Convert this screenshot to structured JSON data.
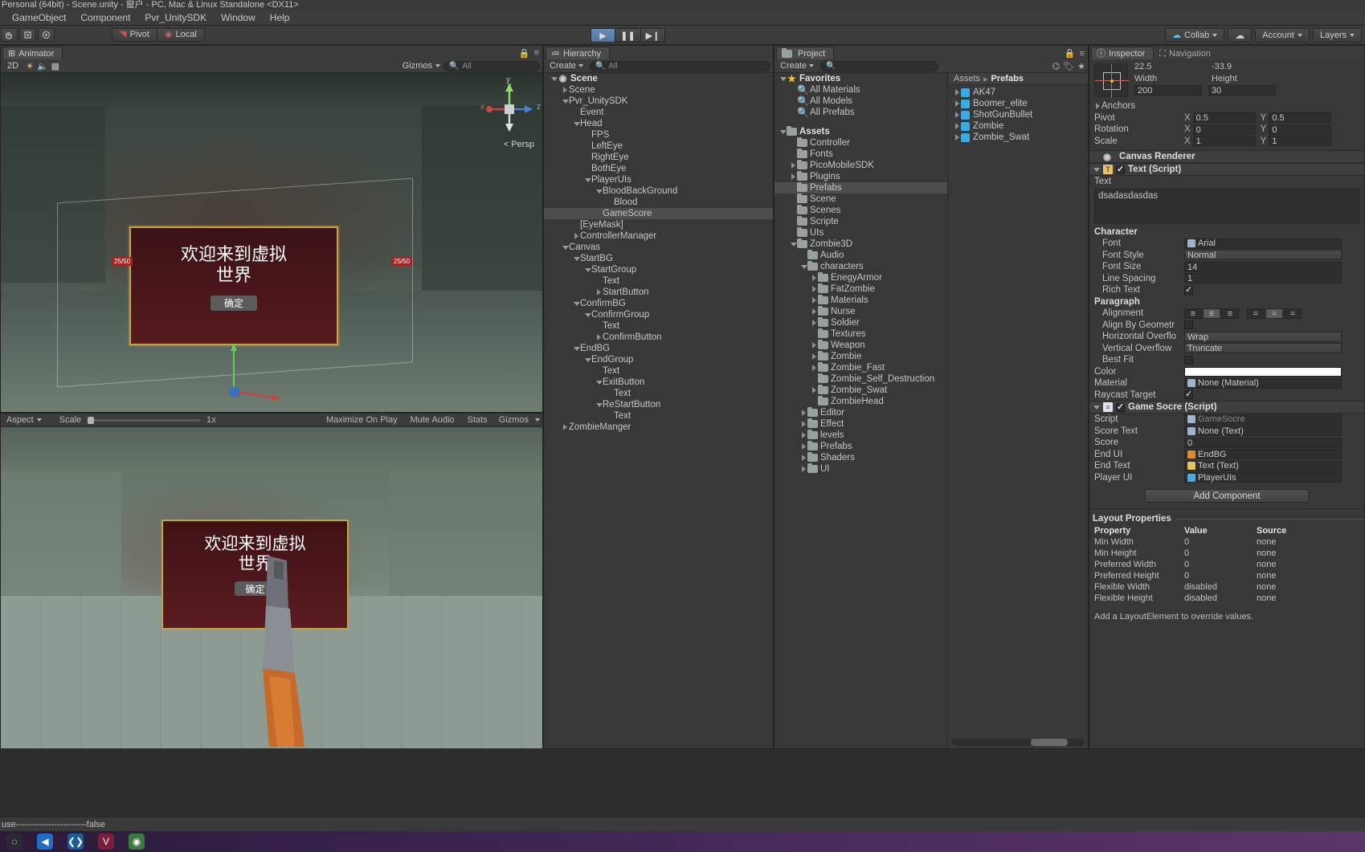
{
  "window": {
    "title": "Personal (64bit) - Scene.unity - 窗户 - PC, Mac & Linux Standalone <DX11>"
  },
  "menubar": {
    "items": [
      "GameObject",
      "Component",
      "Pvr_UnitySDK",
      "Window",
      "Help"
    ]
  },
  "toolbar": {
    "transform_tools": [
      "hand-tool",
      "move-tool",
      "rotate-tool",
      "rect-tool"
    ],
    "pivot_label": "Pivot",
    "local_label": "Local",
    "play_label": "▶",
    "pause_label": "❚❚",
    "step_label": "▶❙",
    "collab_label": "Collab",
    "cloud_label": "cloud",
    "account_label": "Account",
    "layers_label": "Layers"
  },
  "animator_panel": {
    "tab": "Animator",
    "subbar": [
      "2D",
      "light",
      "audio",
      "fx",
      "grid"
    ],
    "gizmos_label": "Gizmos",
    "all_label": "All"
  },
  "scene_view": {
    "persp_label": "Persp",
    "axis_x": "x",
    "axis_y": "y",
    "axis_z": "z",
    "overlay_title_line1": "欢迎来到虚拟",
    "overlay_title_line2": "世界",
    "overlay_button": "确定",
    "hp_left": "25/50",
    "hp_right": "25/50"
  },
  "game_panel": {
    "aspect_label": "Aspect",
    "scale_label": "Scale",
    "scale_value": "1x",
    "maximize_label": "Maximize On Play",
    "mute_label": "Mute Audio",
    "stats_label": "Stats",
    "gizmos_label": "Gizmos",
    "overlay_title_line1": "欢迎来到虚拟",
    "overlay_title_line2": "世界",
    "overlay_button": "确定"
  },
  "hierarchy": {
    "tab": "Hierarchy",
    "create_label": "Create",
    "search_placeholder": "All",
    "items": [
      {
        "label": "Scene",
        "depth": 0,
        "tri": "down",
        "icon": "unity",
        "bold": true
      },
      {
        "label": "Scene",
        "depth": 1,
        "tri": "right",
        "icon": "none"
      },
      {
        "label": "Pvr_UnitySDK",
        "depth": 1,
        "tri": "down",
        "icon": "none"
      },
      {
        "label": "Event",
        "depth": 2,
        "tri": "none",
        "icon": "none"
      },
      {
        "label": "Head",
        "depth": 2,
        "tri": "down",
        "icon": "none"
      },
      {
        "label": "FPS",
        "depth": 3,
        "tri": "none",
        "icon": "none"
      },
      {
        "label": "LeftEye",
        "depth": 3,
        "tri": "none",
        "icon": "none"
      },
      {
        "label": "RightEye",
        "depth": 3,
        "tri": "none",
        "icon": "none"
      },
      {
        "label": "BothEye",
        "depth": 3,
        "tri": "none",
        "icon": "none"
      },
      {
        "label": "PlayerUIs",
        "depth": 3,
        "tri": "down",
        "icon": "none"
      },
      {
        "label": "BloodBackGround",
        "depth": 4,
        "tri": "down",
        "icon": "none"
      },
      {
        "label": "Blood",
        "depth": 5,
        "tri": "none",
        "icon": "none"
      },
      {
        "label": "GameScore",
        "depth": 4,
        "tri": "none",
        "icon": "none",
        "selected": true
      },
      {
        "label": "[EyeMask]",
        "depth": 2,
        "tri": "none",
        "icon": "none"
      },
      {
        "label": "ControllerManager",
        "depth": 2,
        "tri": "right",
        "icon": "none"
      },
      {
        "label": "Canvas",
        "depth": 1,
        "tri": "down",
        "icon": "none"
      },
      {
        "label": "StartBG",
        "depth": 2,
        "tri": "down",
        "icon": "none"
      },
      {
        "label": "StartGroup",
        "depth": 3,
        "tri": "down",
        "icon": "none"
      },
      {
        "label": "Text",
        "depth": 4,
        "tri": "none",
        "icon": "none"
      },
      {
        "label": "StartButton",
        "depth": 4,
        "tri": "right",
        "icon": "none"
      },
      {
        "label": "ConfirmBG",
        "depth": 2,
        "tri": "down",
        "icon": "none"
      },
      {
        "label": "ConfirmGroup",
        "depth": 3,
        "tri": "down",
        "icon": "none"
      },
      {
        "label": "Text",
        "depth": 4,
        "tri": "none",
        "icon": "none"
      },
      {
        "label": "ConfirmButton",
        "depth": 4,
        "tri": "right",
        "icon": "none"
      },
      {
        "label": "EndBG",
        "depth": 2,
        "tri": "down",
        "icon": "none"
      },
      {
        "label": "EndGroup",
        "depth": 3,
        "tri": "down",
        "icon": "none"
      },
      {
        "label": "Text",
        "depth": 4,
        "tri": "none",
        "icon": "none"
      },
      {
        "label": "ExitButton",
        "depth": 4,
        "tri": "down",
        "icon": "none"
      },
      {
        "label": "Text",
        "depth": 5,
        "tri": "none",
        "icon": "none"
      },
      {
        "label": "ReStartButton",
        "depth": 4,
        "tri": "down",
        "icon": "none"
      },
      {
        "label": "Text",
        "depth": 5,
        "tri": "none",
        "icon": "none"
      },
      {
        "label": "ZombieManger",
        "depth": 1,
        "tri": "right",
        "icon": "none"
      }
    ]
  },
  "project": {
    "tab": "Project",
    "create_label": "Create",
    "search_placeholder": "",
    "tree": [
      {
        "label": "Favorites",
        "depth": 0,
        "tri": "down",
        "icon": "star",
        "bold": true
      },
      {
        "label": "All Materials",
        "depth": 1,
        "tri": "none",
        "icon": "search"
      },
      {
        "label": "All Models",
        "depth": 1,
        "tri": "none",
        "icon": "search"
      },
      {
        "label": "All Prefabs",
        "depth": 1,
        "tri": "none",
        "icon": "search"
      },
      {
        "label": "",
        "depth": 0,
        "tri": "none",
        "icon": "none",
        "spacer": true
      },
      {
        "label": "Assets",
        "depth": 0,
        "tri": "down",
        "icon": "folder",
        "bold": true
      },
      {
        "label": "Controller",
        "depth": 1,
        "tri": "none",
        "icon": "folder"
      },
      {
        "label": "Fonts",
        "depth": 1,
        "tri": "none",
        "icon": "folder"
      },
      {
        "label": "PicoMobileSDK",
        "depth": 1,
        "tri": "right",
        "icon": "folder"
      },
      {
        "label": "Plugins",
        "depth": 1,
        "tri": "right",
        "icon": "folder"
      },
      {
        "label": "Prefabs",
        "depth": 1,
        "tri": "none",
        "icon": "folder",
        "selected": true
      },
      {
        "label": "Scene",
        "depth": 1,
        "tri": "none",
        "icon": "folder"
      },
      {
        "label": "Scenes",
        "depth": 1,
        "tri": "none",
        "icon": "folder"
      },
      {
        "label": "Scripte",
        "depth": 1,
        "tri": "none",
        "icon": "folder"
      },
      {
        "label": "UIs",
        "depth": 1,
        "tri": "none",
        "icon": "folder"
      },
      {
        "label": "Zombie3D",
        "depth": 1,
        "tri": "down",
        "icon": "folder"
      },
      {
        "label": "Audio",
        "depth": 2,
        "tri": "none",
        "icon": "folder"
      },
      {
        "label": "characters",
        "depth": 2,
        "tri": "down",
        "icon": "folder"
      },
      {
        "label": "EnegyArmor",
        "depth": 3,
        "tri": "right",
        "icon": "folder"
      },
      {
        "label": "FatZombie",
        "depth": 3,
        "tri": "right",
        "icon": "folder"
      },
      {
        "label": "Materials",
        "depth": 3,
        "tri": "right",
        "icon": "folder"
      },
      {
        "label": "Nurse",
        "depth": 3,
        "tri": "right",
        "icon": "folder"
      },
      {
        "label": "Soldier",
        "depth": 3,
        "tri": "right",
        "icon": "folder"
      },
      {
        "label": "Textures",
        "depth": 3,
        "tri": "none",
        "icon": "folder"
      },
      {
        "label": "Weapon",
        "depth": 3,
        "tri": "right",
        "icon": "folder"
      },
      {
        "label": "Zombie",
        "depth": 3,
        "tri": "right",
        "icon": "folder"
      },
      {
        "label": "Zombie_Fast",
        "depth": 3,
        "tri": "right",
        "icon": "folder"
      },
      {
        "label": "Zombie_Self_Destruction",
        "depth": 3,
        "tri": "none",
        "icon": "folder"
      },
      {
        "label": "Zombie_Swat",
        "depth": 3,
        "tri": "right",
        "icon": "folder"
      },
      {
        "label": "ZombieHead",
        "depth": 3,
        "tri": "none",
        "icon": "folder"
      },
      {
        "label": "Editor",
        "depth": 2,
        "tri": "right",
        "icon": "folder"
      },
      {
        "label": "Effect",
        "depth": 2,
        "tri": "right",
        "icon": "folder"
      },
      {
        "label": "levels",
        "depth": 2,
        "tri": "right",
        "icon": "folder"
      },
      {
        "label": "Prefabs",
        "depth": 2,
        "tri": "right",
        "icon": "folder"
      },
      {
        "label": "Shaders",
        "depth": 2,
        "tri": "right",
        "icon": "folder"
      },
      {
        "label": "UI",
        "depth": 2,
        "tri": "right",
        "icon": "folder"
      }
    ],
    "breadcrumb": [
      "Assets",
      "Prefabs"
    ],
    "contents": [
      {
        "label": "AK47"
      },
      {
        "label": "Boomer_elite"
      },
      {
        "label": "ShotGunBullet"
      },
      {
        "label": "Zombie"
      },
      {
        "label": "Zombie_Swat"
      }
    ]
  },
  "inspector": {
    "tab": "Inspector",
    "nav_tab": "Navigation",
    "rect": {
      "posy_value": "22.5",
      "posz_value": "-33.9",
      "width_label": "Width",
      "height_label": "Height",
      "width_value": "200",
      "height_value": "30"
    },
    "anchors_label": "Anchors",
    "transform": [
      {
        "label": "Pivot",
        "x": "0.5",
        "y": "0.5"
      },
      {
        "label": "Rotation",
        "x": "0",
        "y": "0"
      },
      {
        "label": "Scale",
        "x": "1",
        "y": "1"
      }
    ],
    "canvas_renderer_label": "Canvas Renderer",
    "text_script": {
      "title": "Text (Script)",
      "enabled": true,
      "text_label": "Text",
      "text_value": "dsadasdasdas",
      "character_label": "Character",
      "fields": [
        {
          "label": "Font",
          "value": "Arial",
          "type": "object"
        },
        {
          "label": "Font Style",
          "value": "Normal",
          "type": "dropdown"
        },
        {
          "label": "Font Size",
          "value": "14",
          "type": "number"
        },
        {
          "label": "Line Spacing",
          "value": "1",
          "type": "number"
        },
        {
          "label": "Rich Text",
          "value": "",
          "type": "checkbox",
          "checked": true
        }
      ],
      "paragraph_label": "Paragraph",
      "paragraph": [
        {
          "label": "Alignment",
          "value": "",
          "type": "alignbtns"
        },
        {
          "label": "Align By Geometr",
          "value": "",
          "type": "checkbox",
          "checked": false
        },
        {
          "label": "Horizontal Overflo",
          "value": "Wrap",
          "type": "dropdown"
        },
        {
          "label": "Vertical Overflow",
          "value": "Truncate",
          "type": "dropdown"
        },
        {
          "label": "Best Fit",
          "value": "",
          "type": "checkbox",
          "checked": false
        }
      ],
      "tail": [
        {
          "label": "Color",
          "value": "",
          "type": "color",
          "color": "#ffffff"
        },
        {
          "label": "Material",
          "value": "None (Material)",
          "type": "object"
        },
        {
          "label": "Raycast Target",
          "value": "",
          "type": "checkbox",
          "checked": true
        }
      ]
    },
    "game_score_script": {
      "title": "Game Socre (Script)",
      "enabled": true,
      "fields": [
        {
          "label": "Script",
          "value": "GameSocre",
          "type": "script",
          "dim": true
        },
        {
          "label": "Score Text",
          "value": "None (Text)",
          "type": "object"
        },
        {
          "label": "Score",
          "value": "0",
          "type": "number"
        },
        {
          "label": "End UI",
          "value": "EndBG",
          "type": "object",
          "swatch": "#e08a2a"
        },
        {
          "label": "End Text",
          "value": "Text (Text)",
          "type": "object",
          "swatch": "#e3c060"
        },
        {
          "label": "Player UI",
          "value": "PlayerUIs",
          "type": "object",
          "swatch": "#4fa8e0"
        }
      ]
    },
    "add_component_label": "Add Component",
    "layout_properties": {
      "title": "Layout Properties",
      "columns": [
        "Property",
        "Value",
        "Source"
      ],
      "rows": [
        {
          "property": "Min Width",
          "value": "0",
          "source": "none"
        },
        {
          "property": "Min Height",
          "value": "0",
          "source": "none"
        },
        {
          "property": "Preferred Width",
          "value": "0",
          "source": "none"
        },
        {
          "property": "Preferred Height",
          "value": "0",
          "source": "none"
        },
        {
          "property": "Flexible Width",
          "value": "disabled",
          "source": "none"
        },
        {
          "property": "Flexible Height",
          "value": "disabled",
          "source": "none"
        }
      ],
      "note": "Add a LayoutElement to override values."
    }
  },
  "statusbar": {
    "message": "use------------------------false"
  },
  "colors": {
    "panel_bg": "#383838",
    "panel_dark": "#2d2d2d",
    "selection": "#4d4d4d",
    "accent_yellow": "#f5c518",
    "accent_blue": "#3fa9dd"
  }
}
